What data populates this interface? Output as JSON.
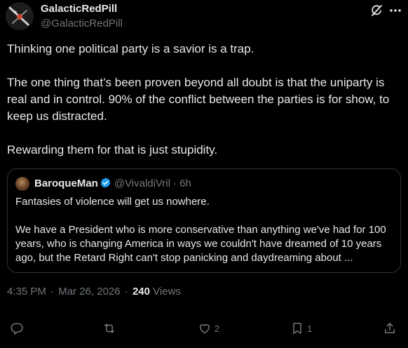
{
  "author": {
    "display_name": "GalacticRedPill",
    "handle": "@GalacticRedPill"
  },
  "post": {
    "paragraphs": [
      "Thinking one political party is a savior is a trap.",
      "The one thing that’s been proven beyond all doubt is that the uniparty is real and in control. 90% of the conflict between the parties is for show, to keep us distracted.",
      "Rewarding them for that is just stupidity."
    ]
  },
  "quoted_post": {
    "display_name": "BaroqueMan",
    "handle": "@VivaldiVril",
    "separator": "·",
    "time": "6h",
    "paragraphs": [
      "Fantasies of violence will get us nowhere.",
      "We have a President who is more conservative than anything we've had for 100 years, who is changing America in ways we couldn't have dreamed of 10 years ago, but the Retard Right can't stop panicking and daydreaming about ..."
    ]
  },
  "meta": {
    "time": "4:35 PM",
    "separator": "·",
    "date": "Mar 26, 2026",
    "views_count": "240",
    "views_label": "Views"
  },
  "actions": {
    "reply_count": "",
    "repost_count": "",
    "like_count": "2",
    "bookmark_count": "1"
  },
  "icons": {
    "grok": "grok-icon",
    "more": "more-icon",
    "verified": "verified-badge-icon",
    "reply": "reply-icon",
    "repost": "repost-icon",
    "like": "heart-icon",
    "bookmark": "bookmark-icon",
    "share": "share-icon"
  },
  "colors": {
    "background": "#000000",
    "text_primary": "#e7e9ea",
    "text_secondary": "#71767b",
    "border": "#2f3336",
    "verified": "#1d9bf0"
  }
}
